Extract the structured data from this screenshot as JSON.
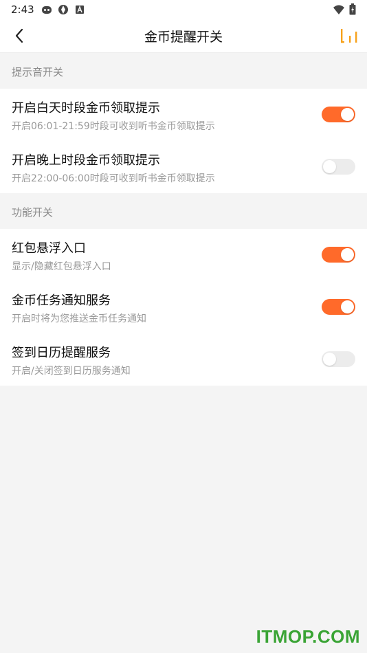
{
  "status_bar": {
    "time": "2:43",
    "icons": [
      "app-icon",
      "aperture-icon",
      "font-icon",
      "wifi-icon",
      "battery-icon"
    ]
  },
  "header": {
    "title": "金币提醒开关",
    "back_icon": "chevron-left-icon",
    "right_icon": "bar-chart-icon"
  },
  "sections": [
    {
      "label": "提示音开关",
      "items": [
        {
          "title": "开启白天时段金币领取提示",
          "subtitle": "开启06:01-21:59时段可收到听书金币领取提示",
          "on": true
        },
        {
          "title": "开启晚上时段金币领取提示",
          "subtitle": "开启22:00-06:00时段可收到听书金币领取提示",
          "on": false
        }
      ]
    },
    {
      "label": "功能开关",
      "items": [
        {
          "title": "红包悬浮入口",
          "subtitle": "显示/隐藏红包悬浮入口",
          "on": true
        },
        {
          "title": "金币任务通知服务",
          "subtitle": "开启时将为您推送金币任务通知",
          "on": true
        },
        {
          "title": "签到日历提醒服务",
          "subtitle": "开启/关闭签到日历服务通知",
          "on": false
        }
      ]
    }
  ],
  "colors": {
    "accent": "#ff6a2a",
    "switch_off": "#ececec",
    "watermark": "#3aa435"
  },
  "watermark": "ITMOP.COM"
}
